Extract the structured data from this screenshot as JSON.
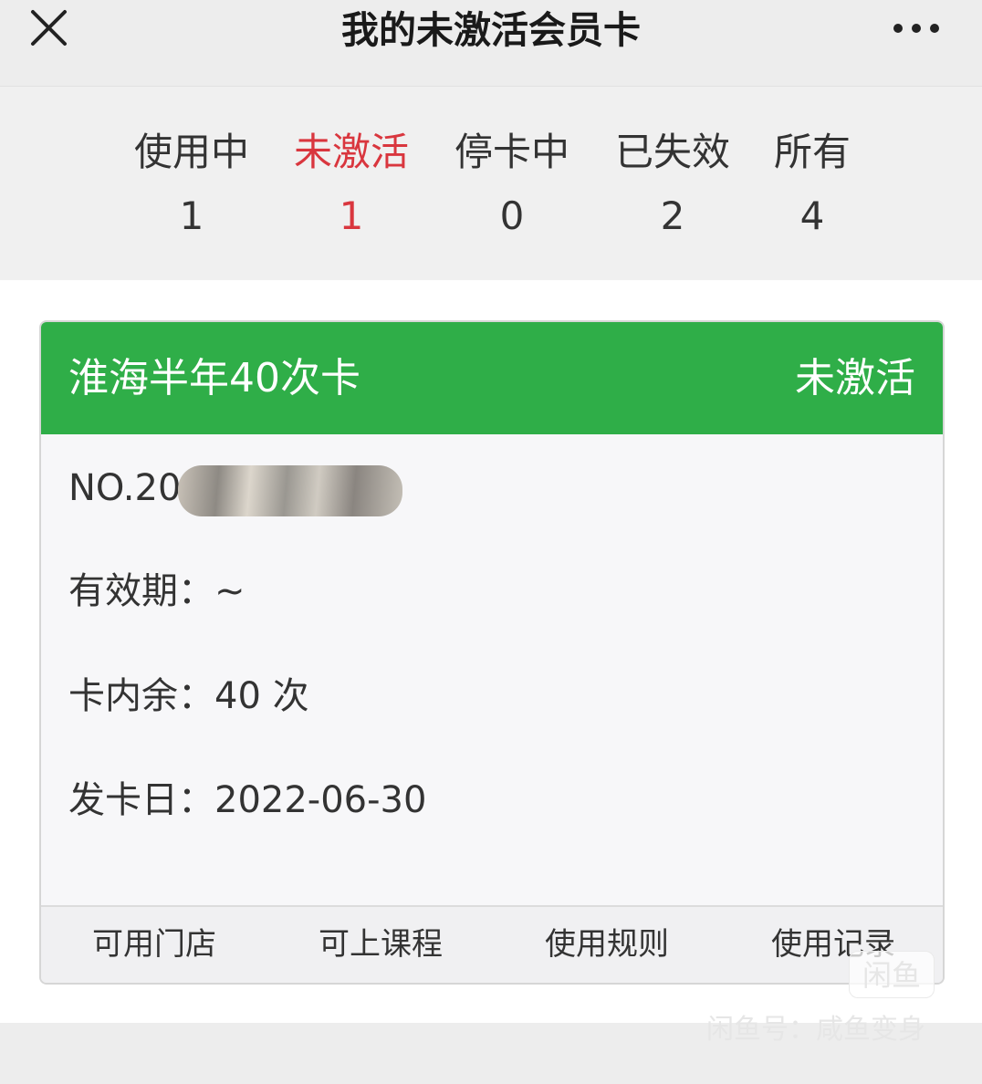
{
  "header": {
    "title": "我的未激活会员卡",
    "close_icon": "close-icon",
    "more_icon": "more-horizontal-icon"
  },
  "tabs": [
    {
      "label": "使用中",
      "count": "1",
      "active": false
    },
    {
      "label": "未激活",
      "count": "1",
      "active": true
    },
    {
      "label": "停卡中",
      "count": "0",
      "active": false
    },
    {
      "label": "已失效",
      "count": "2",
      "active": false
    },
    {
      "label": "所有",
      "count": "4",
      "active": false
    }
  ],
  "card": {
    "name": "淮海半年40次卡",
    "status": "未激活",
    "number": "NO.20",
    "validity": "有效期：~",
    "remaining": "卡内余：40 次",
    "issued": "发卡日：2022-06-30",
    "footer": [
      "可用门店",
      "可上课程",
      "使用规则",
      "使用记录"
    ]
  },
  "watermark": {
    "logo": "闲鱼",
    "text": "闲鱼号：咸鱼变身"
  },
  "colors": {
    "card_header": "#2fae48",
    "active_tab": "#d9363e",
    "background": "#ededed"
  }
}
